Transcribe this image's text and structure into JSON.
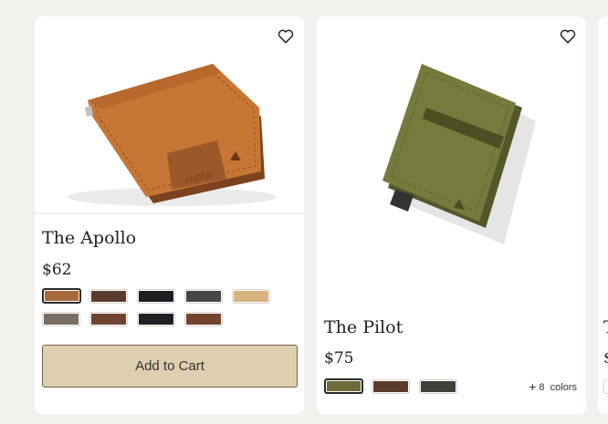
{
  "products": [
    {
      "title": "The Apollo",
      "price": "$62",
      "swatches": [
        "#a86a3a",
        "#5b3c2c",
        "#1c1e22",
        "#444844",
        "#d7b27f",
        "#7a6d63",
        "#6e4430",
        "#1e2024",
        "#73442f"
      ],
      "selected_swatch": 0,
      "add_to_cart": "Add to Cart",
      "image_icon": "wallet-icon",
      "wishlist_icon": "heart-icon"
    },
    {
      "title": "The Pilot",
      "price": "$75",
      "swatches": [
        "#6e6a39",
        "#5a3a29",
        "#3e4139"
      ],
      "selected_swatch": 0,
      "more_colors_count": "8",
      "more_colors_label": "colors",
      "image_icon": "wallet-icon",
      "wishlist_icon": "heart-icon"
    }
  ],
  "peek": {
    "title": "T",
    "price": "$"
  },
  "colors": {
    "page_bg": "#f3f1ee",
    "button_bg": "#dfcfae",
    "button_border": "#6f6454"
  }
}
